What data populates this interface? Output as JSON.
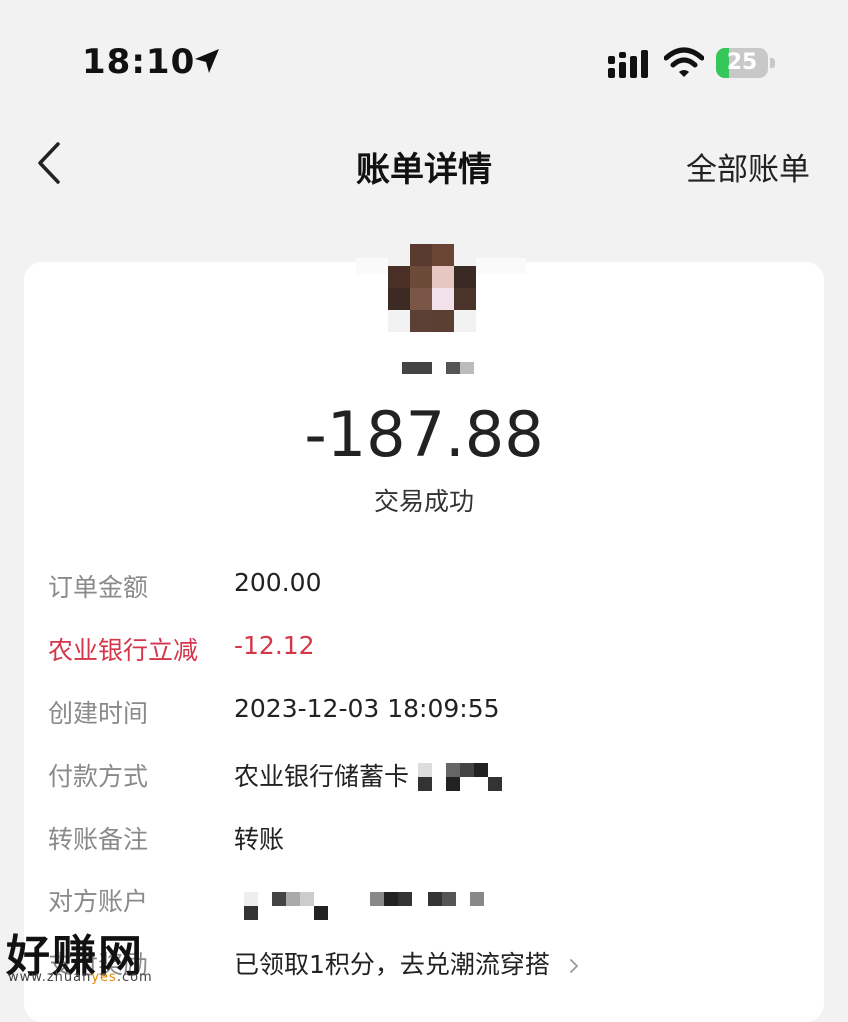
{
  "status_bar": {
    "time": "18:10",
    "battery": "25",
    "battery_level": 0.25,
    "icons": [
      "location-arrow-icon",
      "signal-icon",
      "wifi-icon",
      "battery-icon"
    ]
  },
  "nav": {
    "title": "账单详情",
    "right_link": "全部账单",
    "back_icon": "chevron-left-icon"
  },
  "bill": {
    "amount": "-187.88",
    "status": "交易成功",
    "rows": [
      {
        "label": "订单金额",
        "value": "200.00"
      },
      {
        "label": "农业银行立减",
        "value": "-12.12"
      },
      {
        "label": "创建时间",
        "value": "2023-12-03 18:09:55"
      },
      {
        "label": "付款方式",
        "value": "农业银行储蓄卡"
      },
      {
        "label": "转账备注",
        "value": "转账"
      },
      {
        "label": "对方账户",
        "value": ""
      },
      {
        "label": "支付奖励",
        "value": "已领取1积分，去兑潮流穿搭"
      }
    ]
  },
  "colors": {
    "discount": "#d6364a",
    "battery_green": "#35c759",
    "background": "#f2f2f2"
  },
  "watermark": {
    "main": "好赚网",
    "url_prefix": "www.zhuan",
    "url_yes": "yes",
    "url_suffix": ".com"
  }
}
